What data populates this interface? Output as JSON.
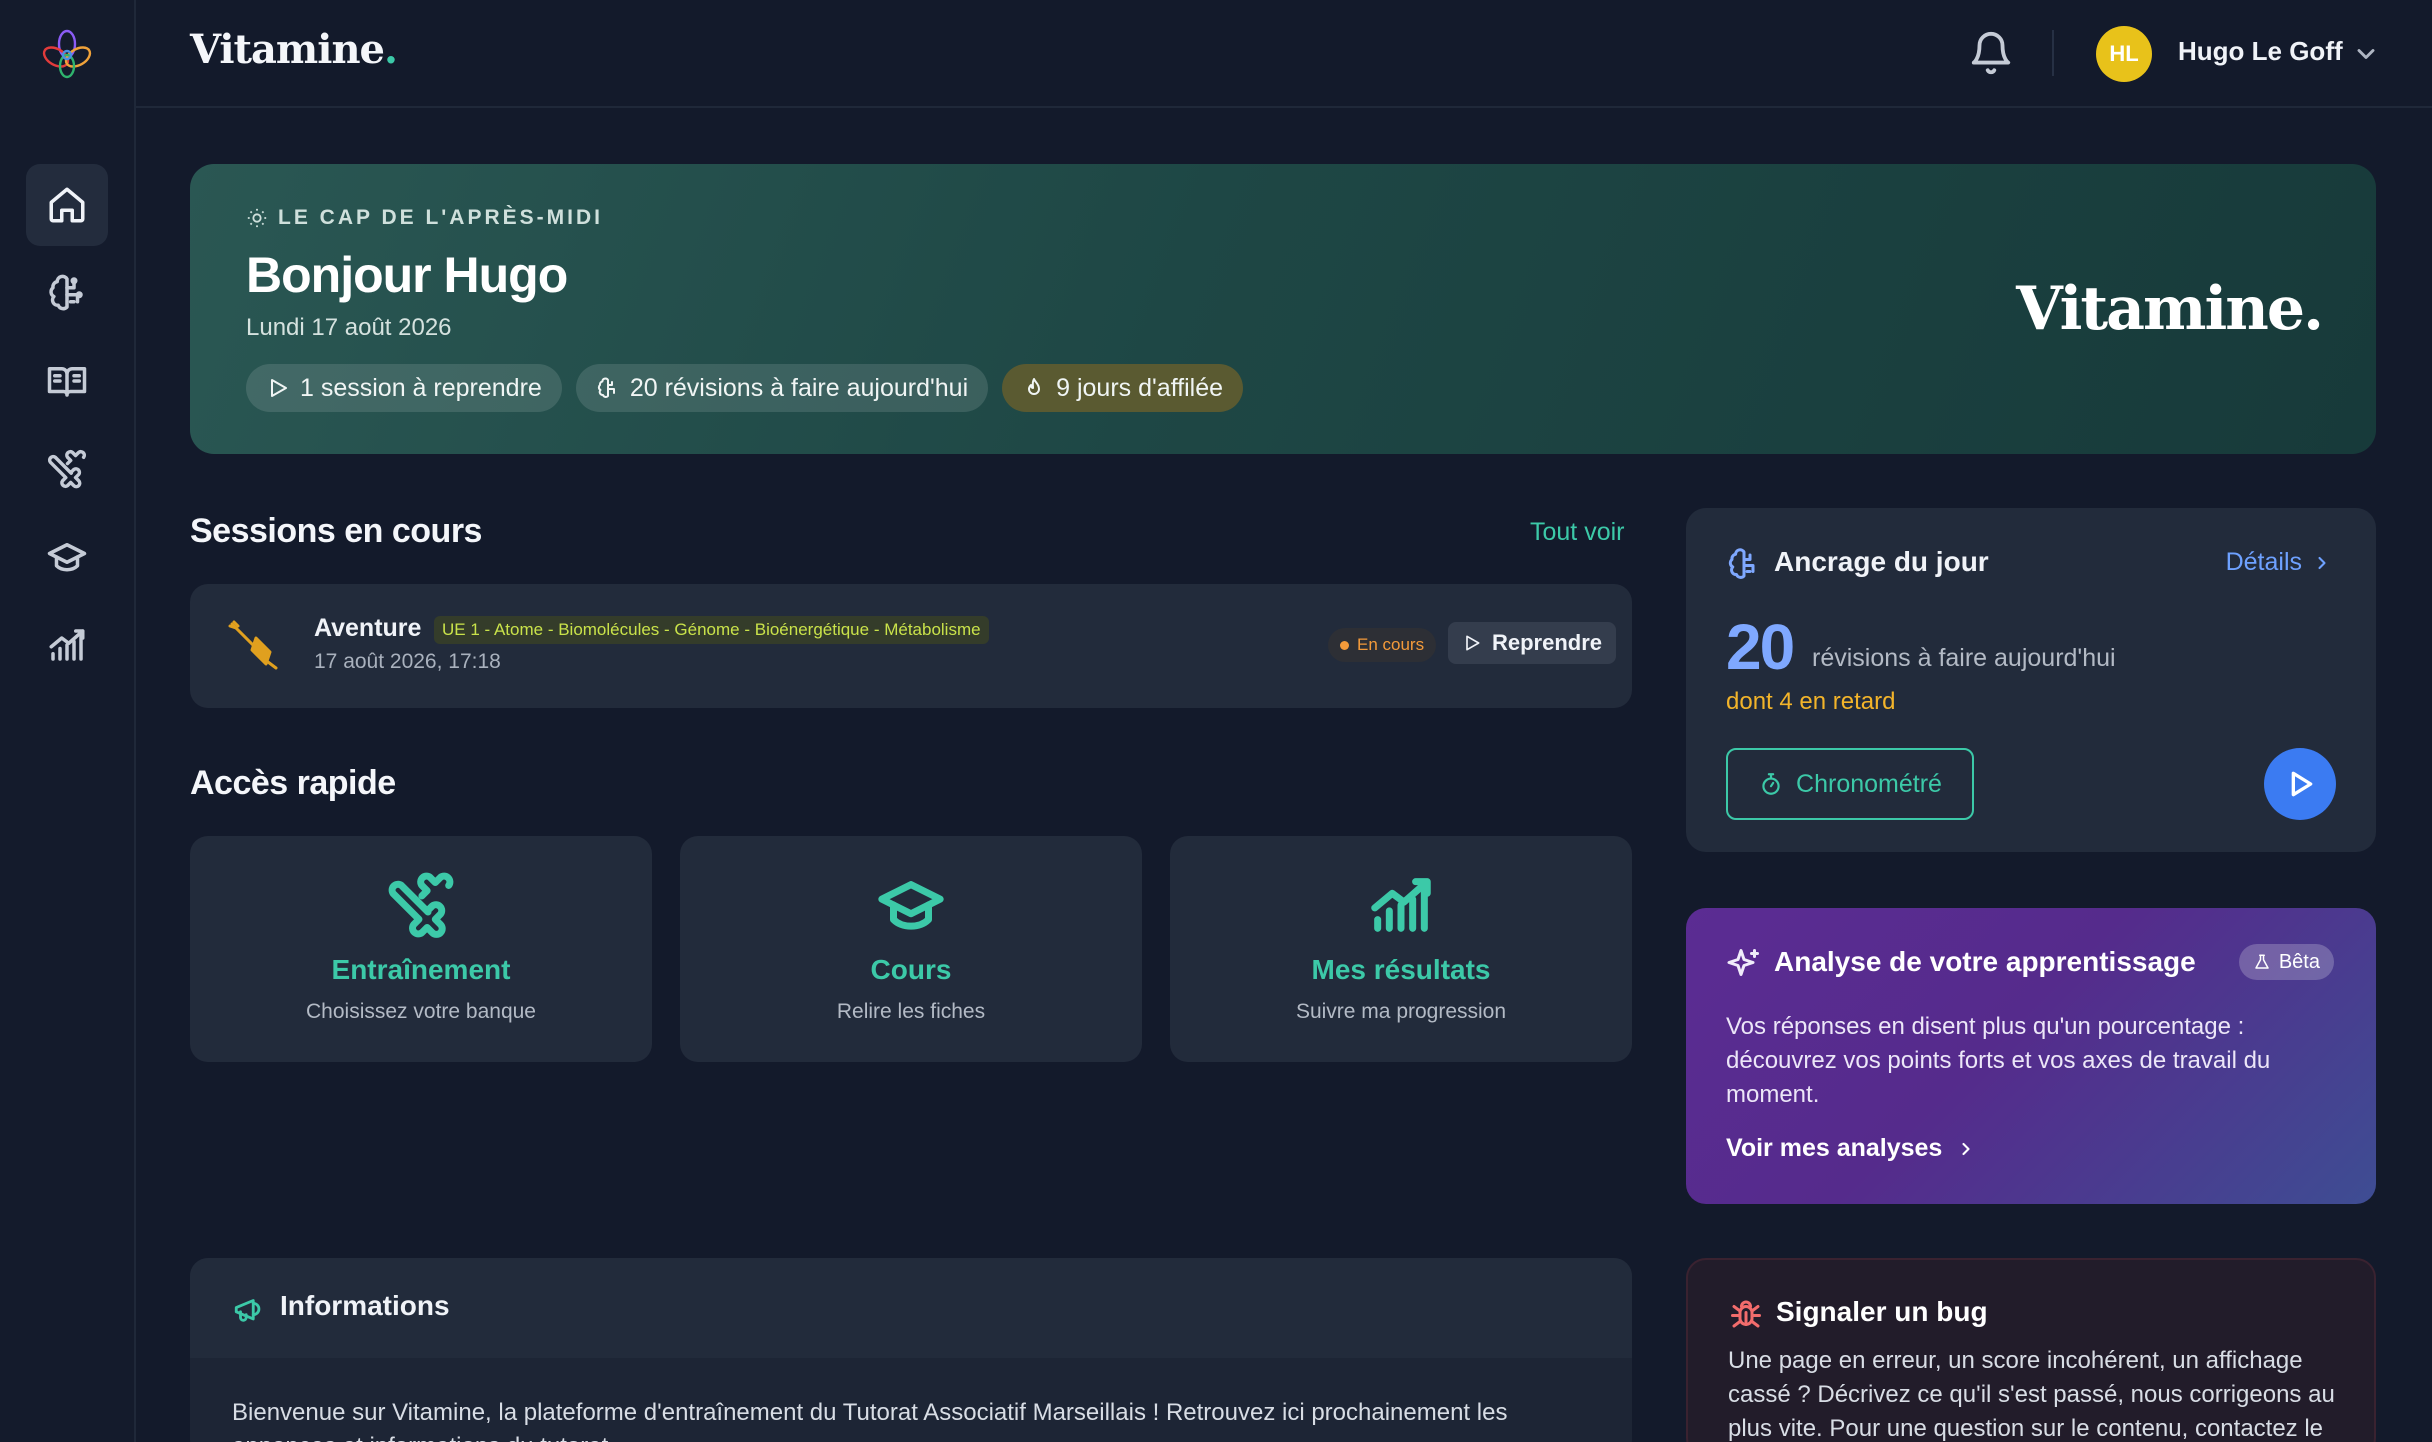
{
  "app": {
    "brand": "Vitamine",
    "brand_dot": "."
  },
  "colors": {
    "accent": "#3cc9a8",
    "blue": "#3b7bf2",
    "amber": "#f3b42a",
    "danger": "#f26c6c",
    "avatar": "#e8c21a"
  },
  "sidebar": {
    "items": [
      {
        "name": "home",
        "icon": "home-icon",
        "active": true
      },
      {
        "name": "revisions",
        "icon": "brain-icon",
        "active": false
      },
      {
        "name": "courses-book",
        "icon": "book-open-icon",
        "active": false
      },
      {
        "name": "training",
        "icon": "dumbbell-icon",
        "active": false
      },
      {
        "name": "courses",
        "icon": "graduation-cap-icon",
        "active": false
      },
      {
        "name": "results",
        "icon": "chart-icon",
        "active": false
      }
    ]
  },
  "header": {
    "user_initials": "HL",
    "user_name": "Hugo Le Goff"
  },
  "hero": {
    "eyebrow": "LE CAP DE L'APRÈS-MIDI",
    "title": "Bonjour Hugo",
    "date": "Lundi 17 août 2026",
    "chips": {
      "sessions": "1 session à reprendre",
      "revisions": "20 révisions à faire aujourd'hui",
      "streak": "9 jours d'affilée"
    },
    "brand": "Vitamine",
    "brand_dot": "."
  },
  "sessions": {
    "title": "Sessions en cours",
    "see_all": "Tout voir",
    "items": [
      {
        "name": "Aventure",
        "tag": "UE 1 - Atome - Biomolécules - Génome - Bioénergétique - Métabolisme",
        "date": "17 août 2026, 17:18",
        "status": "En cours",
        "action": "Reprendre"
      }
    ]
  },
  "quick_access": {
    "title": "Accès rapide",
    "cards": [
      {
        "title": "Entraînement",
        "subtitle": "Choisissez votre banque",
        "icon": "dumbbell-icon"
      },
      {
        "title": "Cours",
        "subtitle": "Relire les fiches",
        "icon": "graduation-cap-icon"
      },
      {
        "title": "Mes résultats",
        "subtitle": "Suivre ma progression",
        "icon": "chart-icon"
      }
    ]
  },
  "informations": {
    "title": "Informations",
    "body": "Bienvenue sur Vitamine, la plateforme d'entraînement du Tutorat Associatif Marseillais ! Retrouvez ici prochainement les annonces et informations du tutorat."
  },
  "anchor": {
    "title": "Ancrage du jour",
    "details": "Détails",
    "count": "20",
    "count_label": "révisions à faire aujourd'hui",
    "late": "dont 4 en retard",
    "chrono": "Chronométré"
  },
  "analysis": {
    "title": "Analyse de votre apprentissage",
    "badge": "Bêta",
    "body": "Vos réponses en disent plus qu'un pourcentage : découvrez vos points forts et vos axes de travail du moment.",
    "link": "Voir mes analyses"
  },
  "bug": {
    "title": "Signaler un bug",
    "body": "Une page en erreur, un score incohérent, un affichage cassé ? Décrivez ce qu'il s'est passé, nous corrigeons au plus vite. Pour une question sur le contenu, contactez le tutorat."
  }
}
